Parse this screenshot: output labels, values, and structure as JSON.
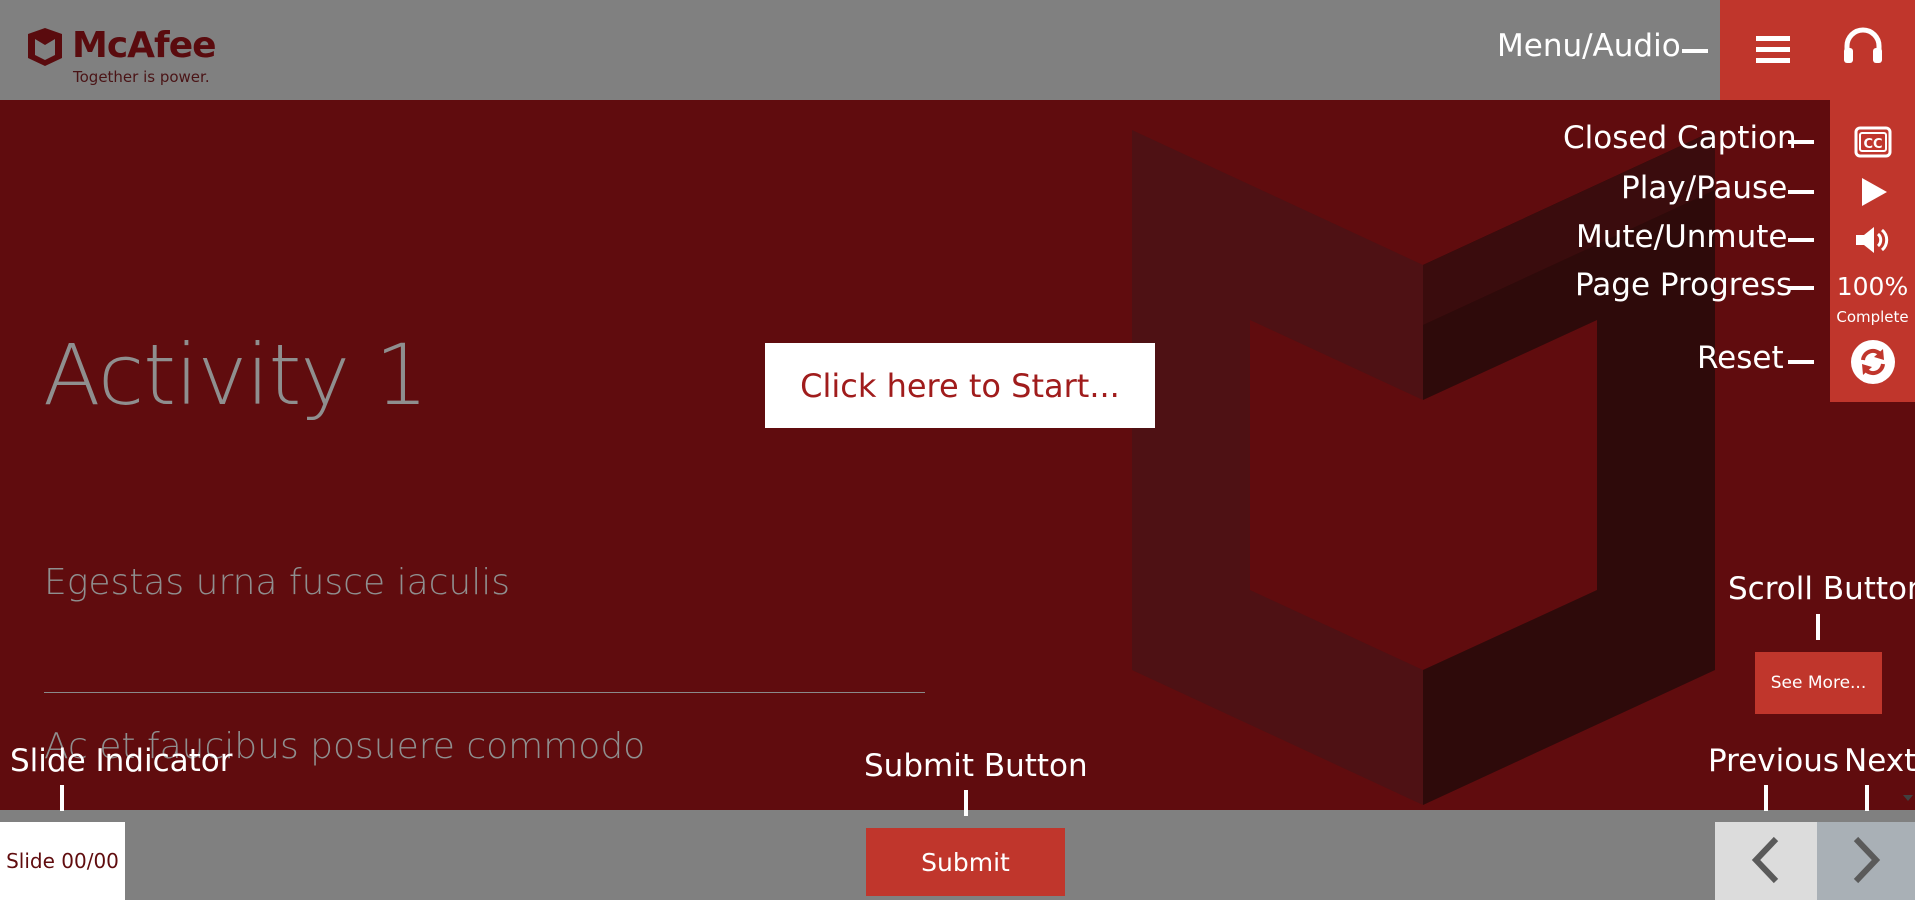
{
  "brand": {
    "name": "McAfee",
    "tagline": "Together is power.",
    "colors": {
      "primary_red": "#c0362c",
      "stage_dark_red": "#600c0e",
      "chrome_gray": "#808080"
    }
  },
  "content": {
    "title": "Activity 1",
    "subtitle_1": "Egestas urna fusce iaculis",
    "subtitle_2": "Ac et faucibus posuere commodo",
    "start_button": "Click here to Start..."
  },
  "controls": {
    "menu_icon": "hamburger-menu-icon",
    "audio_icon": "headphones-icon",
    "cc_icon": "closed-caption-icon",
    "play_icon": "play-icon",
    "volume_icon": "speaker-icon",
    "progress_value": "100%",
    "progress_label": "Complete",
    "reset_icon": "refresh-icon",
    "see_more": "See More..."
  },
  "annotations": {
    "menu_audio": "Menu/Audio",
    "closed_caption": "Closed Caption",
    "play_pause": "Play/Pause",
    "mute_unmute": "Mute/Unmute",
    "page_progress": "Page Progress",
    "reset": "Reset",
    "scroll_button": "Scroll Button",
    "slide_indicator": "Slide Indicator",
    "submit_button": "Submit Button",
    "previous": "Previous",
    "next": "Next"
  },
  "footer": {
    "slide_indicator": "Slide 00/00",
    "submit": "Submit",
    "prev_icon": "chevron-left-icon",
    "next_icon": "chevron-right-icon"
  }
}
